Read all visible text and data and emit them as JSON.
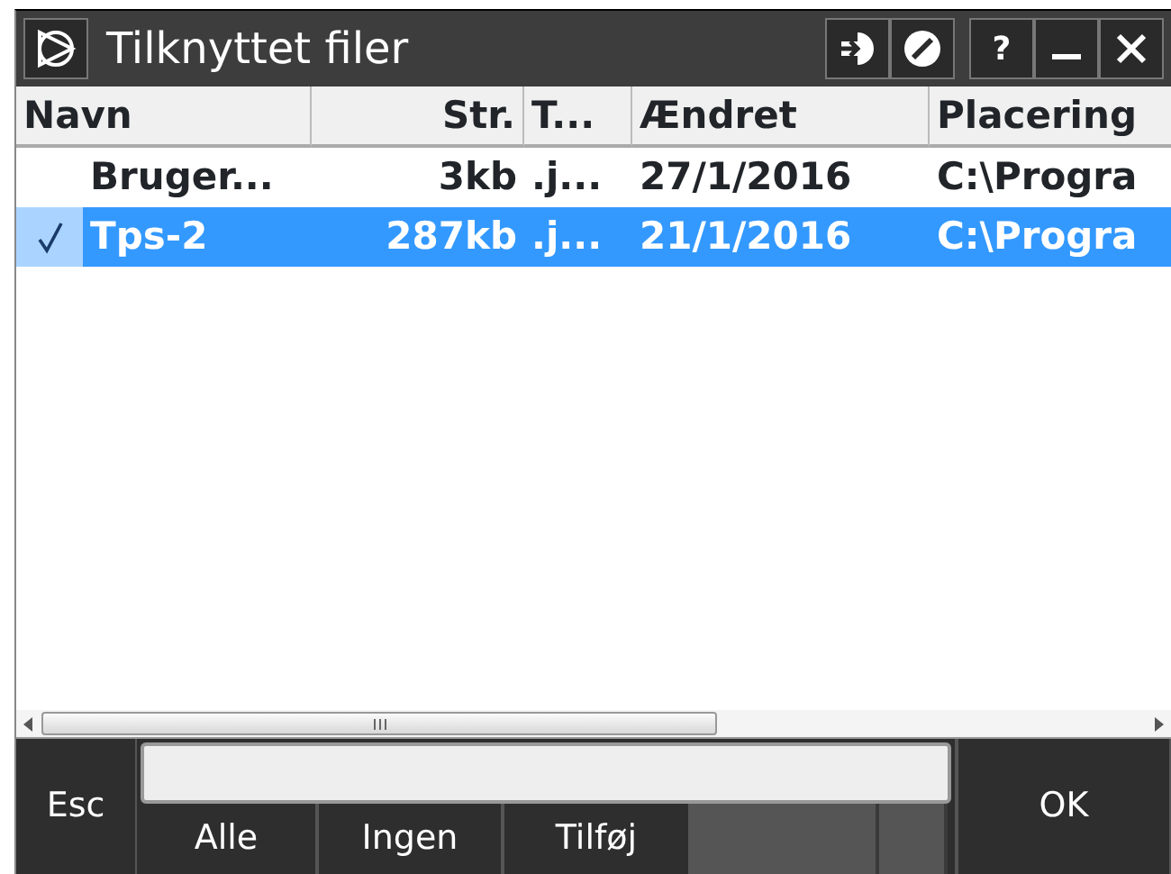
{
  "window": {
    "title": "Tilknyttet filer"
  },
  "title_buttons": [
    {
      "kind": "login"
    },
    {
      "kind": "forbid"
    },
    {
      "kind": "help",
      "label": "?"
    },
    {
      "kind": "minimize"
    },
    {
      "kind": "close"
    }
  ],
  "table": {
    "columns": [
      {
        "label": "Navn",
        "kind": "text"
      },
      {
        "label": "Str.",
        "kind": "number"
      },
      {
        "label": "T...",
        "kind": "text"
      },
      {
        "label": "Ændret",
        "kind": "text"
      },
      {
        "label": "Placering",
        "kind": "text"
      }
    ],
    "rows": [
      {
        "checked": false,
        "selected": false,
        "cells": [
          "Bruger...",
          "3kb",
          ".j...",
          "27/1/2016",
          "C:\\Progra"
        ]
      },
      {
        "checked": true,
        "selected": true,
        "cells": [
          "Tps-2",
          "287kb",
          ".j...",
          "21/1/2016",
          "C:\\Progra"
        ]
      }
    ]
  },
  "softkeys": {
    "esc": "Esc",
    "ok": "OK",
    "buttons": [
      {
        "kind": "key",
        "label": "Alle"
      },
      {
        "kind": "key",
        "label": "Ingen"
      },
      {
        "kind": "key",
        "label": "Tilføj"
      },
      {
        "kind": "blank"
      },
      {
        "kind": "blank"
      }
    ]
  }
}
